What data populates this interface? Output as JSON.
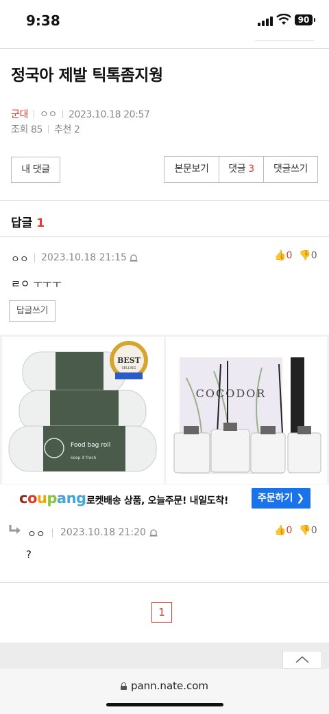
{
  "status": {
    "time": "9:38",
    "battery": "90"
  },
  "post": {
    "title": "정국아 제발 틱톡좀지웡",
    "category": "군대",
    "author": "ㅇㅇ",
    "date": "2023.10.18 20:57",
    "views": "조회 85",
    "recommend": "추천 2"
  },
  "actions": {
    "my_comments": "내 댓글",
    "view_post": "본문보기",
    "comments_label": "댓글",
    "comments_count": "3",
    "write_comment": "댓글쓰기"
  },
  "replies": {
    "label": "답글",
    "count": "1"
  },
  "comments": [
    {
      "author": "ㅇㅇ",
      "date": "2023.10.18 21:15",
      "likes": "0",
      "dislikes": "0",
      "text": "ㄹㅇ ㅜㅜㅜ",
      "reply_button": "답글쓰기"
    },
    {
      "author": "ㅇㅇ",
      "date": "2023.10.18 21:20",
      "likes": "0",
      "dislikes": "0",
      "text": "?"
    }
  ],
  "ad": {
    "left_label": "Food bag roll",
    "left_sub": "keep it fresh",
    "badge_top": "BEST",
    "badge_bottom": "SELLING",
    "right_brand": "COCODOR",
    "logo": "coupang",
    "text": "로켓배송 상품, 오늘주문! 내일도착!",
    "cta": "주문하기"
  },
  "pagination": {
    "current": "1"
  },
  "browser": {
    "url": "pann.nate.com"
  },
  "colors": {
    "accent": "#e0392d",
    "cta": "#1a73e8"
  }
}
